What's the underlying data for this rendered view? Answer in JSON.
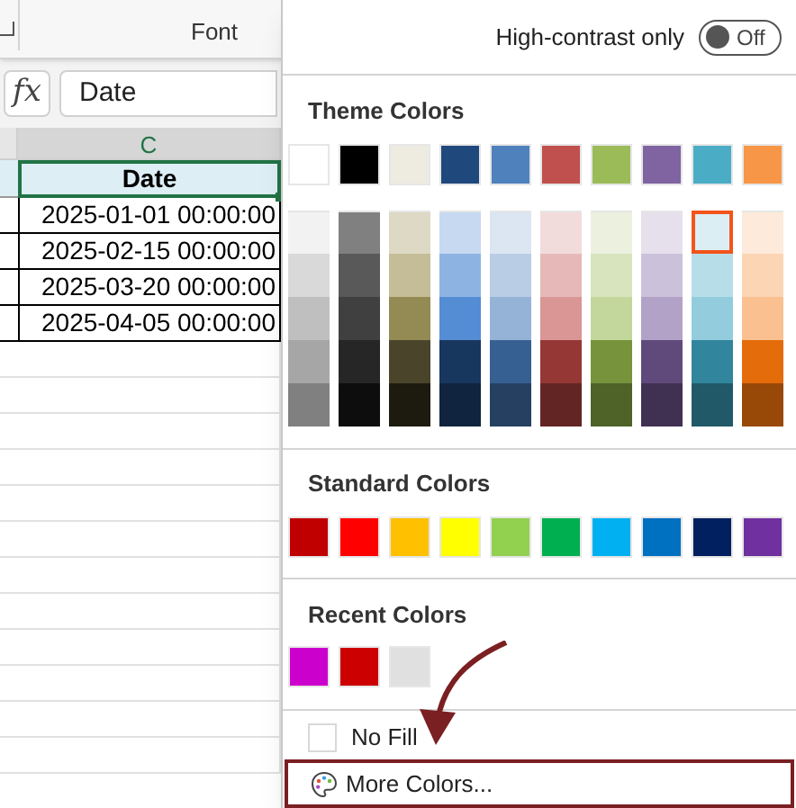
{
  "ribbon": {
    "group_label": "Font"
  },
  "formula_bar": {
    "function_label": "fx",
    "value": "Date"
  },
  "sheet": {
    "column_header": "C",
    "header_cell": "Date",
    "rows": [
      "2025-01-01 00:00:00",
      "2025-02-15 00:00:00",
      "2025-03-20 00:00:00",
      "2025-04-05 00:00:00"
    ]
  },
  "color_menu": {
    "high_contrast": {
      "label": "High-contrast only",
      "on": false,
      "text": "Off"
    },
    "theme_colors": {
      "title": "Theme Colors",
      "columns": [
        {
          "base": {
            "color": "#ffffff",
            "selected": false
          },
          "shades": [
            {
              "color": "#f2f2f2",
              "selected": false
            },
            {
              "color": "#d9d9d9",
              "selected": false
            },
            {
              "color": "#bfbfbf",
              "selected": false
            },
            {
              "color": "#a6a6a6",
              "selected": false
            },
            {
              "color": "#808080",
              "selected": false
            }
          ]
        },
        {
          "base": {
            "color": "#000000",
            "selected": false
          },
          "shades": [
            {
              "color": "#808080",
              "selected": false
            },
            {
              "color": "#595959",
              "selected": false
            },
            {
              "color": "#404040",
              "selected": false
            },
            {
              "color": "#262626",
              "selected": false
            },
            {
              "color": "#0d0d0d",
              "selected": false
            }
          ]
        },
        {
          "base": {
            "color": "#eeece1",
            "selected": false
          },
          "shades": [
            {
              "color": "#ddd9c4",
              "selected": false
            },
            {
              "color": "#c4bd97",
              "selected": false
            },
            {
              "color": "#948a54",
              "selected": false
            },
            {
              "color": "#4a452a",
              "selected": false
            },
            {
              "color": "#1d1b10",
              "selected": false
            }
          ]
        },
        {
          "base": {
            "color": "#1f497d",
            "selected": false
          },
          "shades": [
            {
              "color": "#c6d9f1",
              "selected": false
            },
            {
              "color": "#8db3e2",
              "selected": false
            },
            {
              "color": "#548dd4",
              "selected": false
            },
            {
              "color": "#17375e",
              "selected": false
            },
            {
              "color": "#10243f",
              "selected": false
            }
          ]
        },
        {
          "base": {
            "color": "#4f81bd",
            "selected": false
          },
          "shades": [
            {
              "color": "#dce6f2",
              "selected": false
            },
            {
              "color": "#b9cde5",
              "selected": false
            },
            {
              "color": "#95b3d7",
              "selected": false
            },
            {
              "color": "#376092",
              "selected": false
            },
            {
              "color": "#254061",
              "selected": false
            }
          ]
        },
        {
          "base": {
            "color": "#c0504d",
            "selected": false
          },
          "shades": [
            {
              "color": "#f2dcdb",
              "selected": false
            },
            {
              "color": "#e6b9b8",
              "selected": false
            },
            {
              "color": "#d99694",
              "selected": false
            },
            {
              "color": "#953735",
              "selected": false
            },
            {
              "color": "#632523",
              "selected": false
            }
          ]
        },
        {
          "base": {
            "color": "#9bbb59",
            "selected": false
          },
          "shades": [
            {
              "color": "#ebf1de",
              "selected": false
            },
            {
              "color": "#d7e4bd",
              "selected": false
            },
            {
              "color": "#c3d69b",
              "selected": false
            },
            {
              "color": "#77933c",
              "selected": false
            },
            {
              "color": "#4f6228",
              "selected": false
            }
          ]
        },
        {
          "base": {
            "color": "#8064a2",
            "selected": false
          },
          "shades": [
            {
              "color": "#e6e0ec",
              "selected": false
            },
            {
              "color": "#ccc1da",
              "selected": false
            },
            {
              "color": "#b3a2c7",
              "selected": false
            },
            {
              "color": "#604a7b",
              "selected": false
            },
            {
              "color": "#403152",
              "selected": false
            }
          ]
        },
        {
          "base": {
            "color": "#4bacc6",
            "selected": false
          },
          "shades": [
            {
              "color": "#dbeef4",
              "selected": true
            },
            {
              "color": "#b7dee8",
              "selected": false
            },
            {
              "color": "#93cddd",
              "selected": false
            },
            {
              "color": "#31859c",
              "selected": false
            },
            {
              "color": "#215968",
              "selected": false
            }
          ]
        },
        {
          "base": {
            "color": "#f79646",
            "selected": false
          },
          "shades": [
            {
              "color": "#fdeada",
              "selected": false
            },
            {
              "color": "#fcd5b5",
              "selected": false
            },
            {
              "color": "#fac090",
              "selected": false
            },
            {
              "color": "#e46c0a",
              "selected": false
            },
            {
              "color": "#984807",
              "selected": false
            }
          ]
        }
      ]
    },
    "standard_colors": {
      "title": "Standard Colors",
      "swatches": [
        {
          "color": "#c00000"
        },
        {
          "color": "#ff0000"
        },
        {
          "color": "#ffc000"
        },
        {
          "color": "#ffff00"
        },
        {
          "color": "#92d050"
        },
        {
          "color": "#00b050"
        },
        {
          "color": "#00b0f0"
        },
        {
          "color": "#0070c0"
        },
        {
          "color": "#002060"
        },
        {
          "color": "#7030a0"
        }
      ]
    },
    "recent_colors": {
      "title": "Recent Colors",
      "swatches": [
        {
          "color": "#cc00cc"
        },
        {
          "color": "#cc0000"
        },
        {
          "color": "#e0e0e0"
        }
      ]
    },
    "no_fill": {
      "label": "No Fill"
    },
    "more_colors": {
      "label": "More Colors...",
      "highlighted": true
    }
  }
}
